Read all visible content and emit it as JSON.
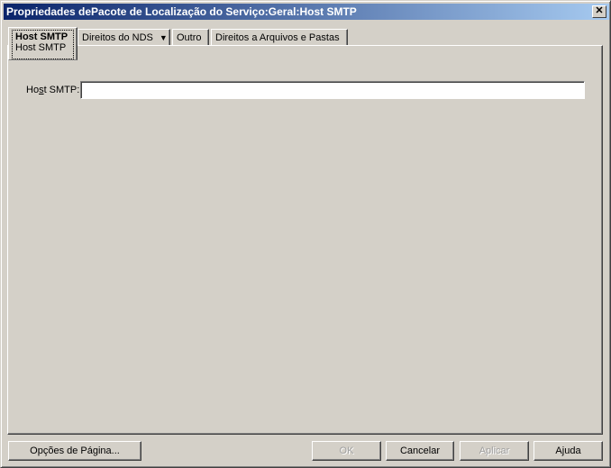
{
  "window": {
    "title": "Propriedades dePacote de Localização do Serviço:Geral:Host SMTP",
    "close_icon": "close-icon"
  },
  "tabs": [
    {
      "label": "Host SMTP",
      "sublabel": "Host SMTP",
      "active": true
    },
    {
      "label": "Direitos do NDS",
      "dropdown": "▼"
    },
    {
      "label": "Outro"
    },
    {
      "label": "Direitos a Arquivos e Pastas"
    }
  ],
  "form": {
    "host_label_pre": "Ho",
    "host_label_u": "s",
    "host_label_post": "t SMTP:",
    "host_value": ""
  },
  "buttons": {
    "page_options": "Opções de Página...",
    "ok": "OK",
    "cancel": "Cancelar",
    "apply": "Aplicar",
    "help": "Ajuda"
  }
}
